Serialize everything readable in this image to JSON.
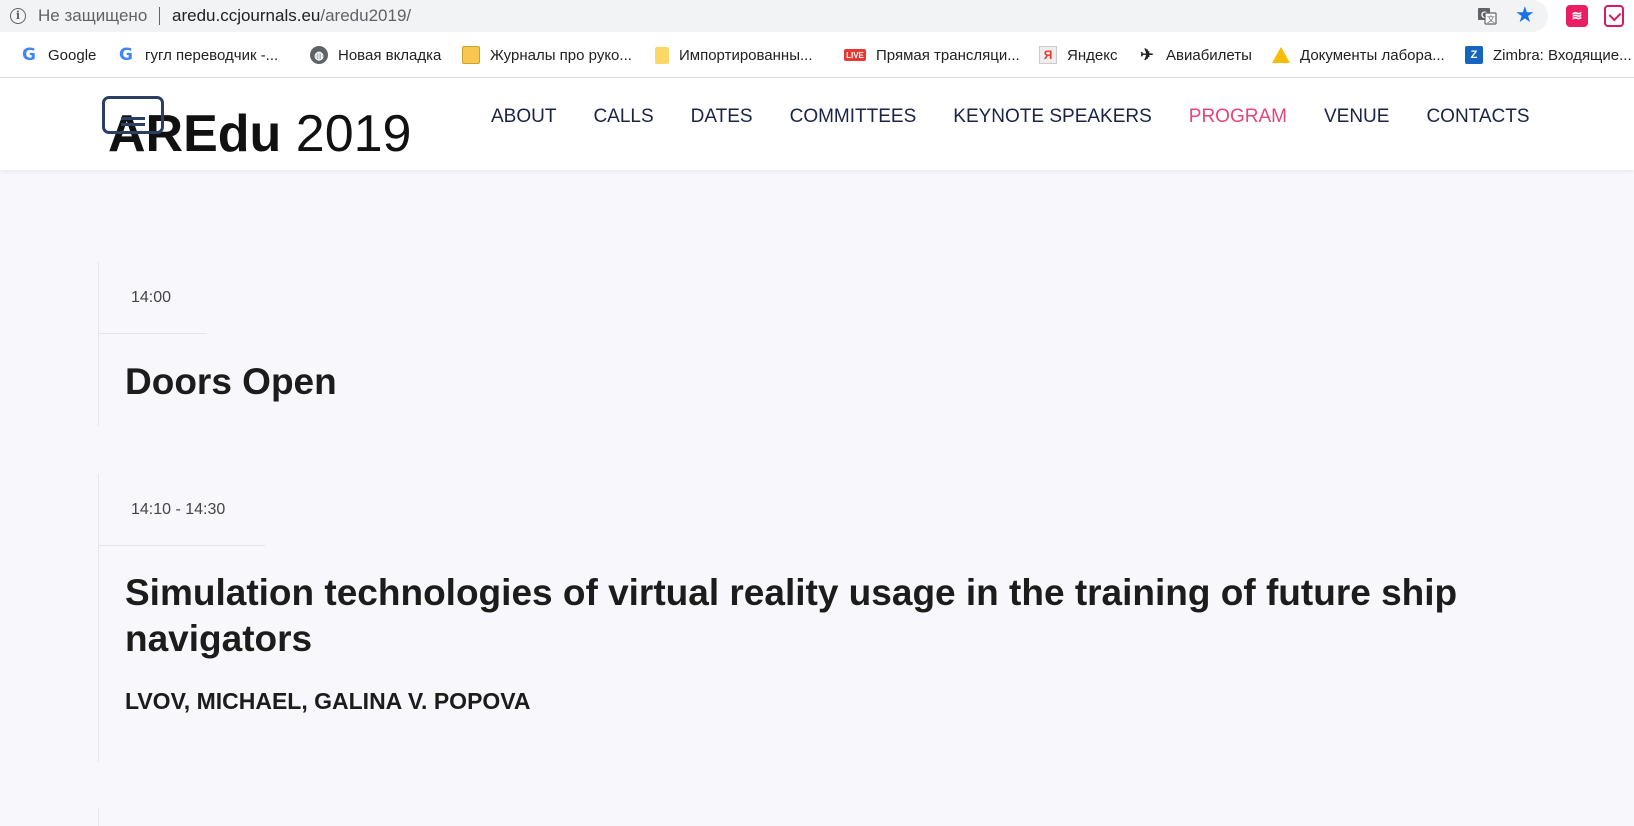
{
  "browser": {
    "security_text": "Не защищено",
    "url_host": "aredu.ccjournals.eu",
    "url_path": "/aredu2019/",
    "icons": [
      "info-icon",
      "translate-icon",
      "star-icon",
      "extension-icon",
      "pocket-icon"
    ]
  },
  "bookmarks": [
    {
      "label": "Google",
      "icon": "google-icon"
    },
    {
      "label": "гугл переводчик -...",
      "icon": "google-icon"
    },
    {
      "label": "Новая вкладка",
      "icon": "globe-icon"
    },
    {
      "label": "Журналы про руко...",
      "icon": "book-icon"
    },
    {
      "label": "Импортированны...",
      "icon": "folder-icon"
    },
    {
      "label": "Прямая трансляци...",
      "icon": "live-icon"
    },
    {
      "label": "Яндекс",
      "icon": "yandex-icon"
    },
    {
      "label": "Авиабилеты",
      "icon": "plane-icon"
    },
    {
      "label": "Документы лабора...",
      "icon": "drive-icon"
    },
    {
      "label": "Zimbra: Входящие...",
      "icon": "zimbra-icon"
    }
  ],
  "site": {
    "logo_text_bold": "AREdu",
    "logo_text_rest": " 2019",
    "nav": [
      {
        "label": "ABOUT",
        "active": false
      },
      {
        "label": "CALLS",
        "active": false
      },
      {
        "label": "DATES",
        "active": false
      },
      {
        "label": "COMMITTEES",
        "active": false
      },
      {
        "label": "KEYNOTE SPEAKERS",
        "active": false
      },
      {
        "label": "PROGRAM",
        "active": true
      },
      {
        "label": "VENUE",
        "active": false
      },
      {
        "label": "CONTACTS",
        "active": false
      }
    ],
    "accent_color": "#e8437c"
  },
  "program": [
    {
      "time": "14:00",
      "title": "Doors Open",
      "authors": ""
    },
    {
      "time": "14:10 - 14:30",
      "title": "Simulation technologies of virtual reality usage in the training of future ship navigators",
      "authors": "LVOV, MICHAEL, GALINA V. POPOVA"
    }
  ]
}
